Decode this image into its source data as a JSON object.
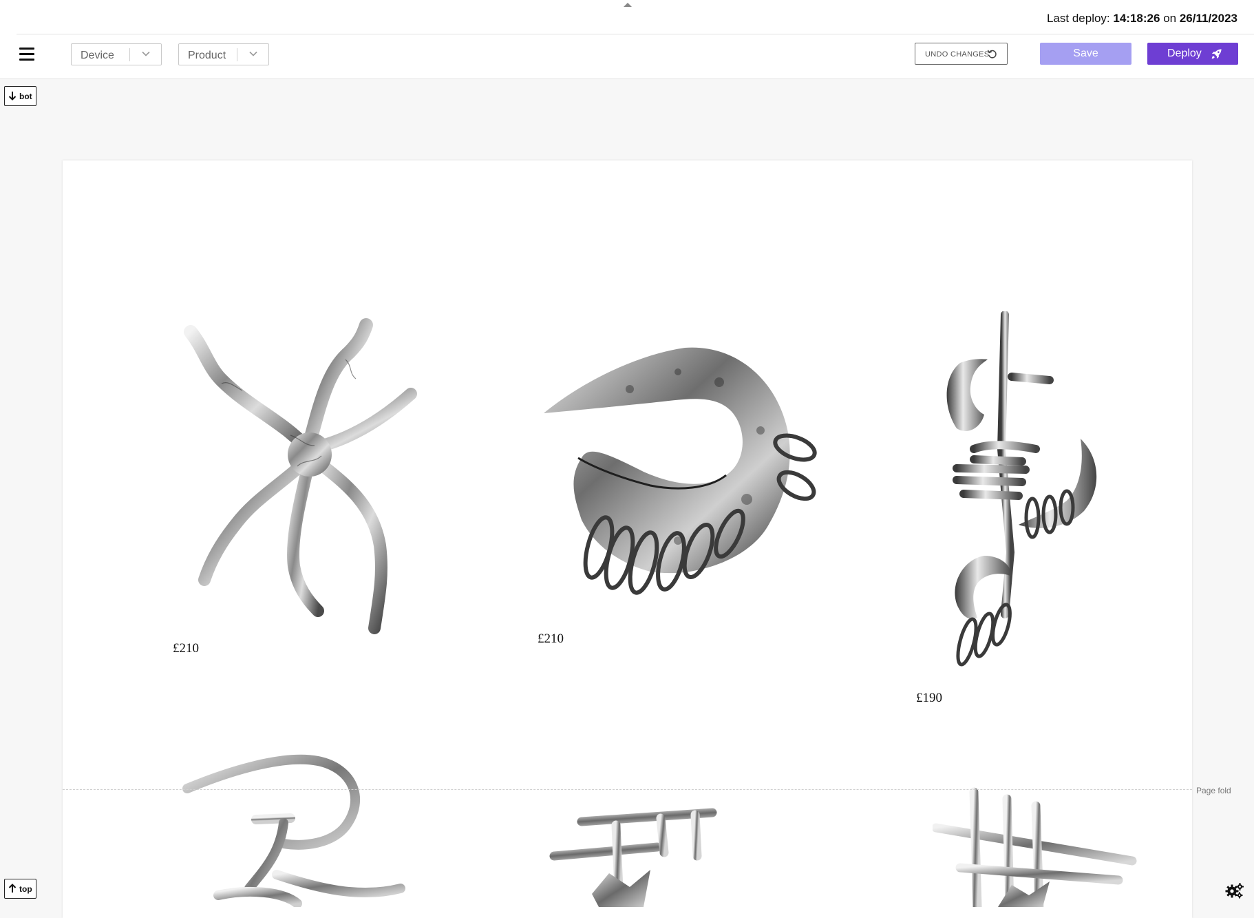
{
  "header": {
    "deploy_prefix": "Last deploy:",
    "deploy_time": "14:18:26",
    "deploy_on": "on",
    "deploy_date": "26/11/2023"
  },
  "toolbar": {
    "device_select": "Device",
    "product_select": "Product",
    "undo_label": "UNDO CHANGES",
    "save_label": "Save",
    "deploy_label": "Deploy"
  },
  "jump": {
    "bottom_label": "bot",
    "top_label": "top"
  },
  "page_fold_label": "Page fold",
  "products": [
    {
      "price": "£210"
    },
    {
      "price": "£210"
    },
    {
      "price": "£190"
    }
  ],
  "colors": {
    "accent": "#6e3ed3",
    "save_disabled": "#a59ff2",
    "canvas_bg": "#ffffff",
    "outer_bg": "#f7f7f7"
  }
}
